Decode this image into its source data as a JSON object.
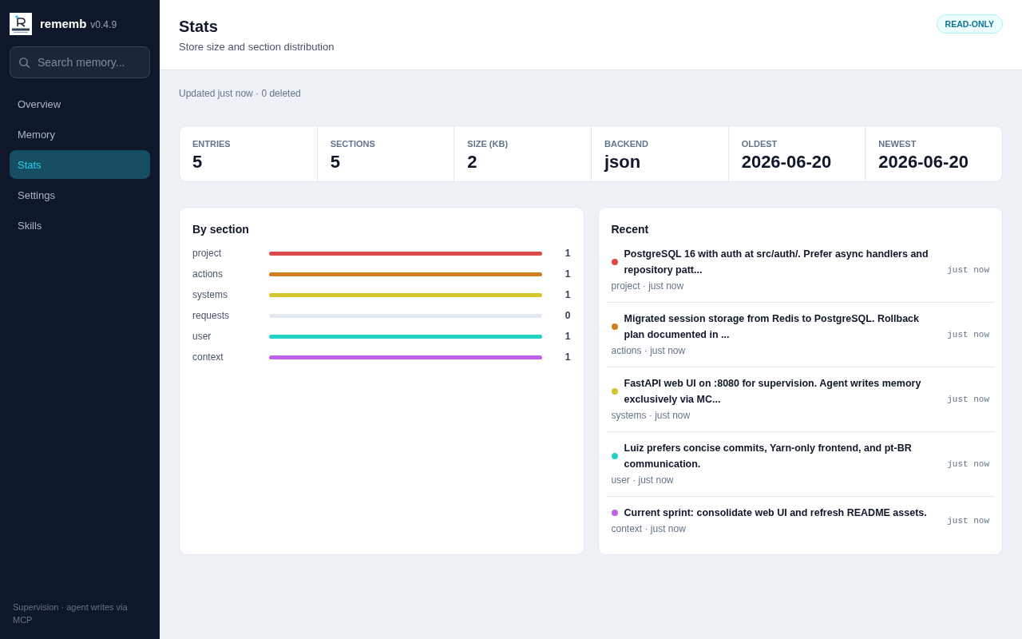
{
  "sidebar": {
    "app_name": "rememb",
    "version": "v0.4.9",
    "search": {
      "placeholder": "Search memory..."
    },
    "nav": [
      {
        "label": "Overview",
        "selected": false
      },
      {
        "label": "Memory",
        "selected": false
      },
      {
        "label": "Stats",
        "selected": true
      },
      {
        "label": "Settings",
        "selected": false
      },
      {
        "label": "Skills",
        "selected": false
      }
    ],
    "footer": "Supervision · agent writes via MCP"
  },
  "header": {
    "title": "Stats",
    "subtitle": "Store size and section distribution",
    "badge": "READ-ONLY"
  },
  "status_line": "Updated just now · 0 deleted",
  "stats": [
    {
      "label": "ENTRIES",
      "value": "5"
    },
    {
      "label": "SECTIONS",
      "value": "5"
    },
    {
      "label": "SIZE (KB)",
      "value": "2"
    },
    {
      "label": "BACKEND",
      "value": "json"
    },
    {
      "label": "OLDEST",
      "value": "2026-06-20"
    },
    {
      "label": "NEWEST",
      "value": "2026-06-20"
    }
  ],
  "by_section": {
    "title": "By section",
    "sections": [
      {
        "name": "project",
        "count": "1",
        "level": 1,
        "color": "#dc4a4a"
      },
      {
        "name": "actions",
        "count": "1",
        "level": 1,
        "color": "#d07f22"
      },
      {
        "name": "systems",
        "count": "1",
        "level": 1,
        "color": "#d4c42e"
      },
      {
        "name": "requests",
        "count": "0",
        "level": 0
      },
      {
        "name": "user",
        "count": "1",
        "level": 1,
        "color": "#22d3c4"
      },
      {
        "name": "context",
        "count": "1",
        "level": 1,
        "color": "#c062ec"
      }
    ]
  },
  "recent": {
    "title": "Recent",
    "items": [
      {
        "text": "PostgreSQL 16 with auth at src/auth/. Prefer async handlers and repository patt...",
        "meta": "project · just now",
        "time": "just now",
        "color": "#dc4a4a"
      },
      {
        "text": "Migrated session storage from Redis to PostgreSQL. Rollback plan documented in ...",
        "meta": "actions · just now",
        "time": "just now",
        "color": "#d07f22"
      },
      {
        "text": "FastAPI web UI on :8080 for supervision. Agent writes memory exclusively via MC...",
        "meta": "systems · just now",
        "time": "just now",
        "color": "#d4c42e"
      },
      {
        "text": "Luiz prefers concise commits, Yarn-only frontend, and pt-BR communication.",
        "meta": "user · just now",
        "time": "just now",
        "color": "#22d3c4"
      },
      {
        "text": "Current sprint: consolidate web UI and refresh README assets.",
        "meta": "context · just now",
        "time": "just now",
        "color": "#c062ec"
      }
    ]
  }
}
